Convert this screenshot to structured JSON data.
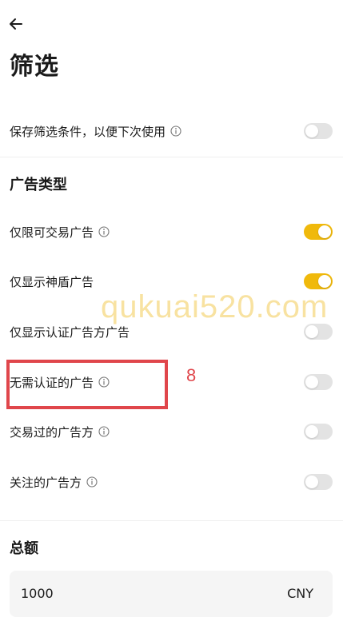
{
  "header": {
    "title": "筛选"
  },
  "save_filter": {
    "label": "保存筛选条件，以便下次使用",
    "enabled": false
  },
  "ad_type": {
    "heading": "广告类型",
    "items": [
      {
        "label": "仅限可交易广告",
        "has_info": true,
        "enabled": true
      },
      {
        "label": "仅显示神盾广告",
        "has_info": false,
        "enabled": true
      },
      {
        "label": "仅显示认证广告方广告",
        "has_info": false,
        "enabled": false
      },
      {
        "label": "无需认证的广告",
        "has_info": true,
        "enabled": false
      },
      {
        "label": "交易过的广告方",
        "has_info": true,
        "enabled": false
      },
      {
        "label": "关注的广告方",
        "has_info": true,
        "enabled": false
      }
    ]
  },
  "total": {
    "heading": "总额",
    "amount": "1000",
    "currency": "CNY"
  },
  "overlay": {
    "watermark": "qukuai520.com",
    "annotation_number": "8"
  },
  "colors": {
    "toggle_on": "#f0b90b",
    "toggle_off": "#e3e3e3",
    "annotation": "#e0464b"
  },
  "icons": {
    "back": "arrow-left-icon",
    "info": "info-circle-icon"
  }
}
